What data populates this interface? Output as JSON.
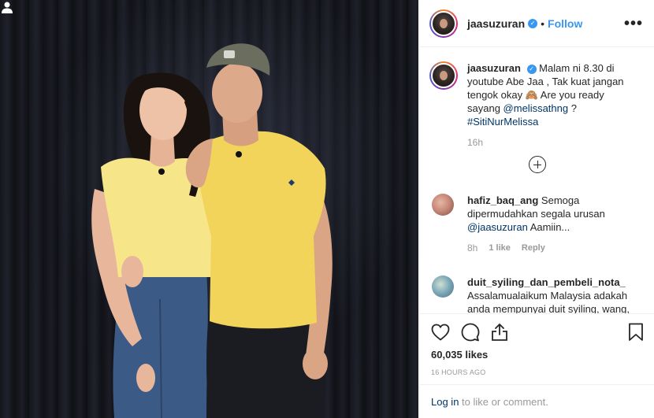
{
  "post": {
    "author": "jaasuzuran",
    "follow_label": "Follow",
    "dot": "•",
    "more": "•••"
  },
  "caption": {
    "username": "jaasuzuran",
    "text_1": "Malam ni 8.30 di youtube Abe Jaa , Tak kuat jangan tengok okay 🙈 Are you ready sayang",
    "mention": "@melissathng",
    "text_2": " ? ",
    "hashtag": "#SitiNurMelissa",
    "time": "16h"
  },
  "comments": [
    {
      "username": "hafiz_baq_ang",
      "text_1": "Semoga dipermudahkan segala urusan",
      "mention": "@jaasuzuran",
      "text_2": " Aamiin...",
      "time": "8h",
      "likes": "1 like",
      "reply": "Reply",
      "avatar_color": "#c98a7a"
    },
    {
      "username": "duit_syiling_dan_pembeli_nota_",
      "text_1": "Assalamualaikum Malaysia adakah anda mempunyai duit syiling, wang, pelayaran, ironsteel, emas, ringgit",
      "avatar_color": "#7aa6b8"
    }
  ],
  "actions": {
    "like_icon": "heart-icon",
    "comment_icon": "comment-icon",
    "share_icon": "share-icon",
    "save_icon": "bookmark-icon",
    "likes_count": "60,035 likes",
    "age": "16 HOURS AGO"
  },
  "login_bar": {
    "login": "Log in",
    "rest": " to like or comment."
  },
  "colors": {
    "link": "#003569",
    "follow": "#3897f0",
    "shirt": "#f2d45a"
  }
}
